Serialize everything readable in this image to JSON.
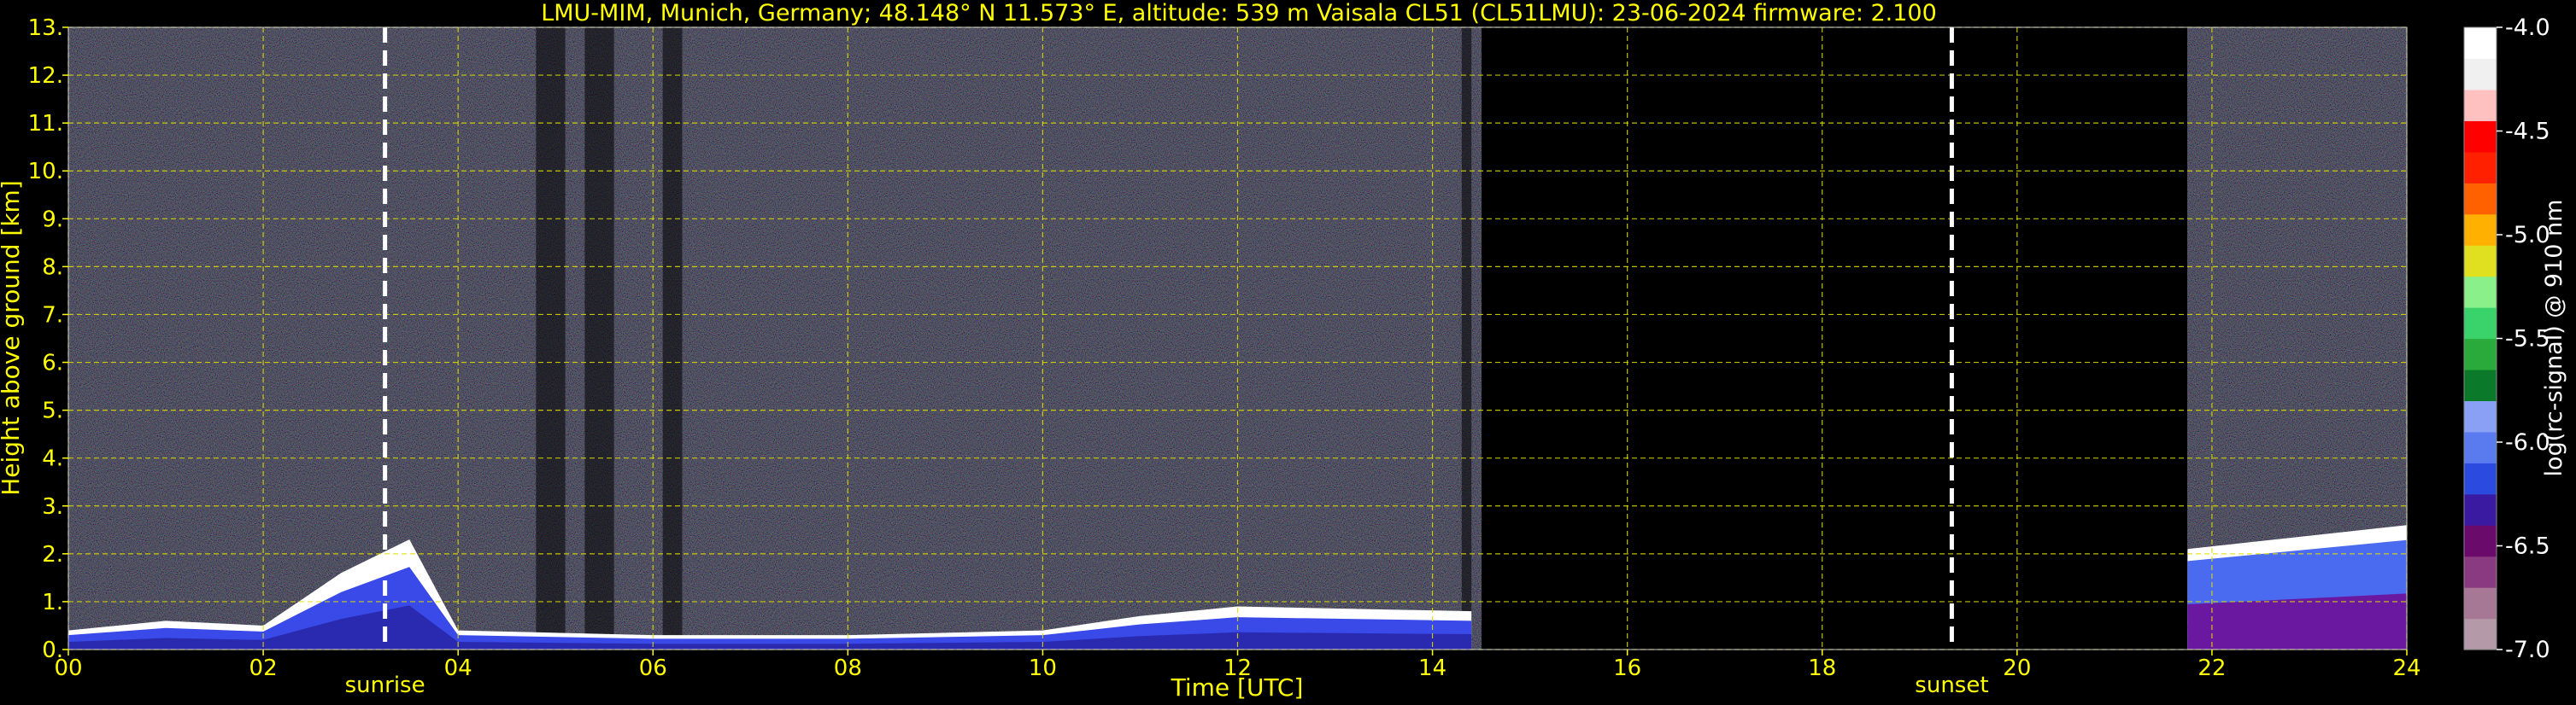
{
  "chart_data": {
    "type": "heatmap",
    "title": "LMU-MIM, Munich, Germany; 48.148° N 11.573° E, altitude: 539 m    Vaisala CL51 (CL51LMU): 23-06-2024    firmware: 2.100",
    "xlabel": "Time [UTC]",
    "ylabel": "Height above ground [km]",
    "xlim": [
      0,
      24
    ],
    "ylim": [
      0,
      13
    ],
    "x_ticks": [
      "00",
      "02",
      "04",
      "06",
      "08",
      "10",
      "12",
      "14",
      "16",
      "18",
      "20",
      "22",
      "24"
    ],
    "y_ticks": [
      "0.",
      "1.",
      "2.",
      "3.",
      "4.",
      "5.",
      "6.",
      "7.",
      "8.",
      "9.",
      "10.",
      "11.",
      "12.",
      "13."
    ],
    "grid": true,
    "events": [
      {
        "label": "sunrise",
        "time_utc": 3.25
      },
      {
        "label": "sunset",
        "time_utc": 19.33
      }
    ],
    "no_data_interval_utc": [
      14.5,
      21.75
    ],
    "boundary_layer_top_km": [
      {
        "t": 0,
        "h": 0.4
      },
      {
        "t": 1,
        "h": 0.6
      },
      {
        "t": 2,
        "h": 0.5
      },
      {
        "t": 2.8,
        "h": 1.6
      },
      {
        "t": 3.5,
        "h": 2.3
      },
      {
        "t": 4,
        "h": 0.4
      },
      {
        "t": 6,
        "h": 0.3
      },
      {
        "t": 8,
        "h": 0.3
      },
      {
        "t": 10,
        "h": 0.4
      },
      {
        "t": 11,
        "h": 0.7
      },
      {
        "t": 12,
        "h": 0.9
      },
      {
        "t": 14.4,
        "h": 0.8
      },
      {
        "t": 21.75,
        "h": 2.1
      },
      {
        "t": 24,
        "h": 2.6
      }
    ],
    "colorbar": {
      "label": "log(rc-signal) @ 910 nm",
      "ticks": [
        "-4.0",
        "-4.5",
        "-5.0",
        "-5.5",
        "-6.0",
        "-6.5",
        "-7.0"
      ],
      "range": [
        -7.0,
        -4.0
      ],
      "colors": [
        "#b49aa8",
        "#a67896",
        "#8a3a80",
        "#6a0a6a",
        "#3a1aa0",
        "#2a4ae0",
        "#5a7af0",
        "#8aa0f4",
        "#0a7a2a",
        "#2aaa3a",
        "#3ad26a",
        "#8af08a",
        "#e0e020",
        "#ffb000",
        "#ff6000",
        "#ff2000",
        "#ff0000",
        "#ffc0c0",
        "#f0f0f0",
        "#ffffff"
      ]
    }
  }
}
